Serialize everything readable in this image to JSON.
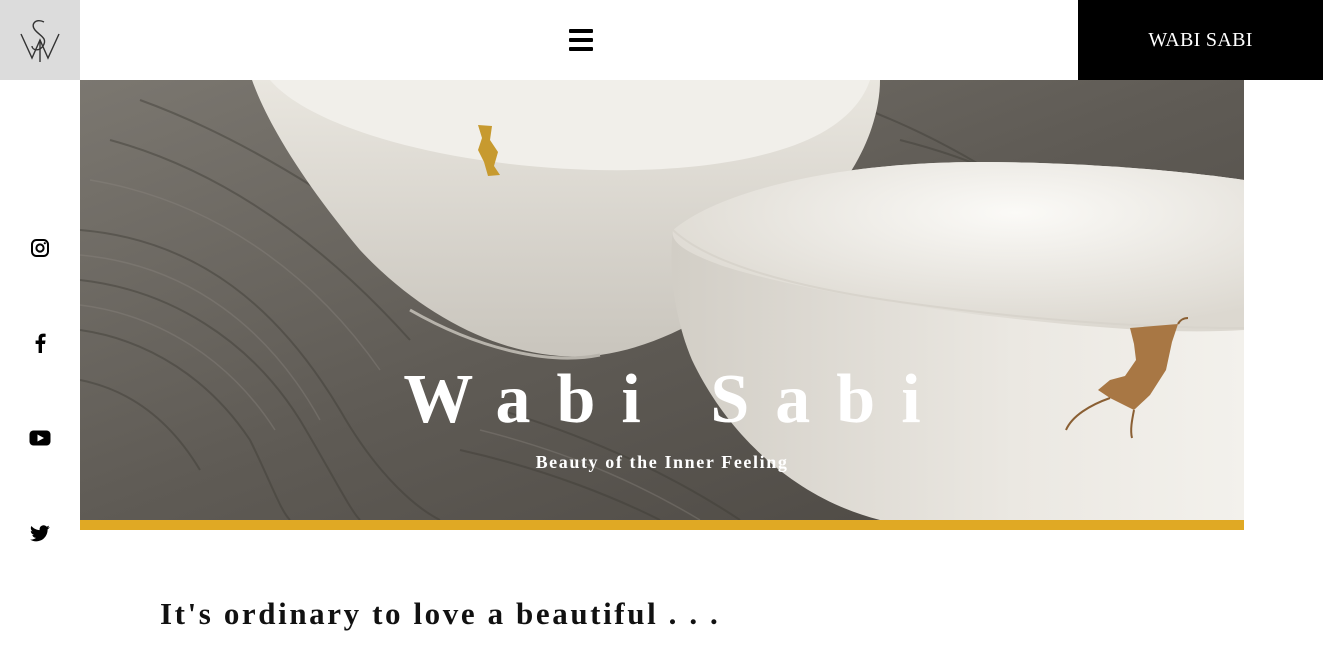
{
  "header": {
    "logo_icon": "ws-monogram-logo",
    "menu_icon": "hamburger-menu-icon",
    "brand_label": "WABI SABI"
  },
  "social": [
    {
      "name": "instagram-icon"
    },
    {
      "name": "facebook-icon"
    },
    {
      "name": "youtube-icon"
    },
    {
      "name": "twitter-icon"
    }
  ],
  "hero": {
    "title": "Wabi Sabi",
    "subtitle": "Beauty of the Inner Feeling",
    "accent_color": "#e0a924"
  },
  "content": {
    "intro": "It's ordinary to love a beautiful . . ."
  }
}
